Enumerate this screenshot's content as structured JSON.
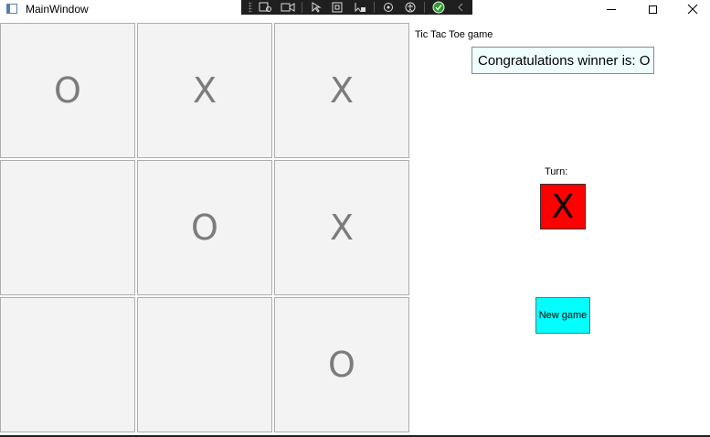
{
  "window": {
    "title": "MainWindow"
  },
  "board": {
    "cells": [
      "O",
      "X",
      "X",
      "",
      "O",
      "X",
      "",
      "",
      "O"
    ]
  },
  "panel": {
    "app_label": "Tic Tac Toe game",
    "winner_text": "Congratulations winner is: O",
    "turn_label": "Turn:",
    "turn_value": "X",
    "new_game_label": "New game"
  },
  "colors": {
    "turn_box": "#ff0000",
    "new_game_button": "#00ffff",
    "winner_box": "#eefeff",
    "cell_background": "#f3f3f3",
    "mark_color": "#7c7c7c"
  }
}
